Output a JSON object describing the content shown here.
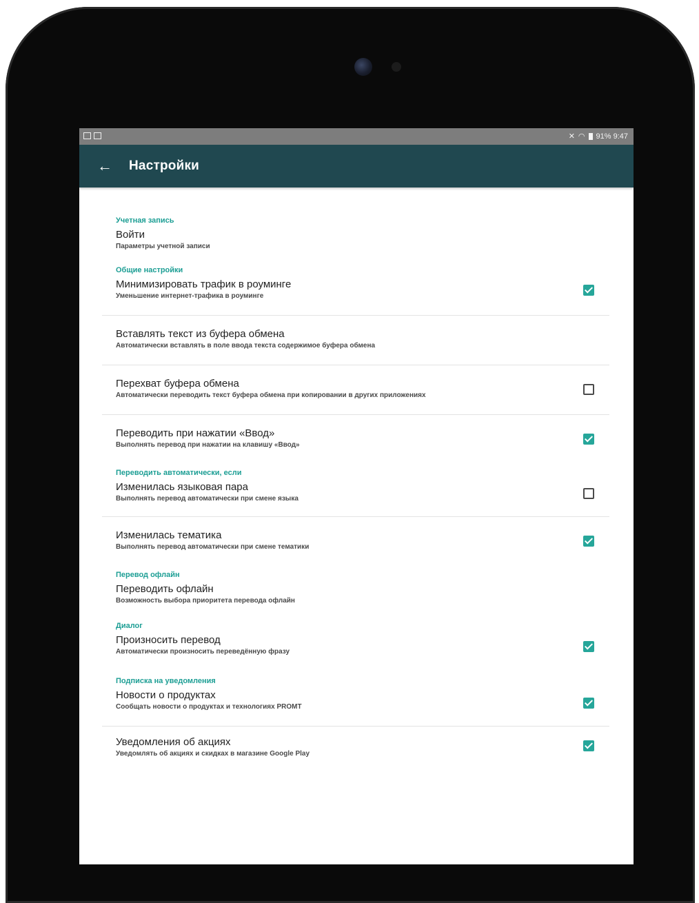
{
  "status_bar": {
    "right": "91%  9:47"
  },
  "app_bar": {
    "title": "Настройки",
    "back_icon": "arrow-left-icon"
  },
  "sections": [
    {
      "header": "Учетная запись",
      "items": [
        {
          "title": "Войти",
          "subtitle": "Параметры учетной записи",
          "checkbox": null
        }
      ]
    },
    {
      "header": "Общие настройки",
      "items": [
        {
          "title": "Минимизировать трафик в роуминге",
          "subtitle": "Уменьшение интернет-трафика в роуминге",
          "checkbox": true
        },
        {
          "title": "Вставлять текст из буфера обмена",
          "subtitle": "Автоматически вставлять в поле ввода текста содержимое буфера обмена",
          "checkbox": null
        },
        {
          "title": "Перехват буфера обмена",
          "subtitle": "Автоматически переводить текст буфера обмена при копировании в других приложениях",
          "checkbox": false
        },
        {
          "title": "Переводить при нажатии «Ввод»",
          "subtitle": "Выполнять перевод при нажатии на клавишу «Ввод»",
          "checkbox": true
        }
      ]
    },
    {
      "header": "Переводить автоматически, если",
      "items": [
        {
          "title": "Изменилась языковая пара",
          "subtitle": "Выполнять перевод автоматически при смене языка",
          "checkbox": false
        },
        {
          "title": "Изменилась тематика",
          "subtitle": "Выполнять перевод автоматически при смене тематики",
          "checkbox": true
        }
      ]
    },
    {
      "header": "Перевод офлайн",
      "items": [
        {
          "title": "Переводить офлайн",
          "subtitle": "Возможность выбора приоритета перевода офлайн",
          "checkbox": null
        }
      ]
    },
    {
      "header": "Диалог",
      "items": [
        {
          "title": "Произносить перевод",
          "subtitle": "Автоматически произносить переведённую фразу",
          "checkbox": true
        }
      ]
    },
    {
      "header": "Подписка на уведомления",
      "items": [
        {
          "title": "Новости о продуктах",
          "subtitle": "Сообщать новости о продуктах и технологиях PROMT",
          "checkbox": true
        },
        {
          "title": "Уведомления об акциях",
          "subtitle": "Уведомлять об акциях и скидках в магазине Google Play",
          "checkbox": true
        }
      ]
    }
  ],
  "colors": {
    "app_bar": "#204850",
    "accent": "#26a69a",
    "section_header": "#1c9e94"
  }
}
